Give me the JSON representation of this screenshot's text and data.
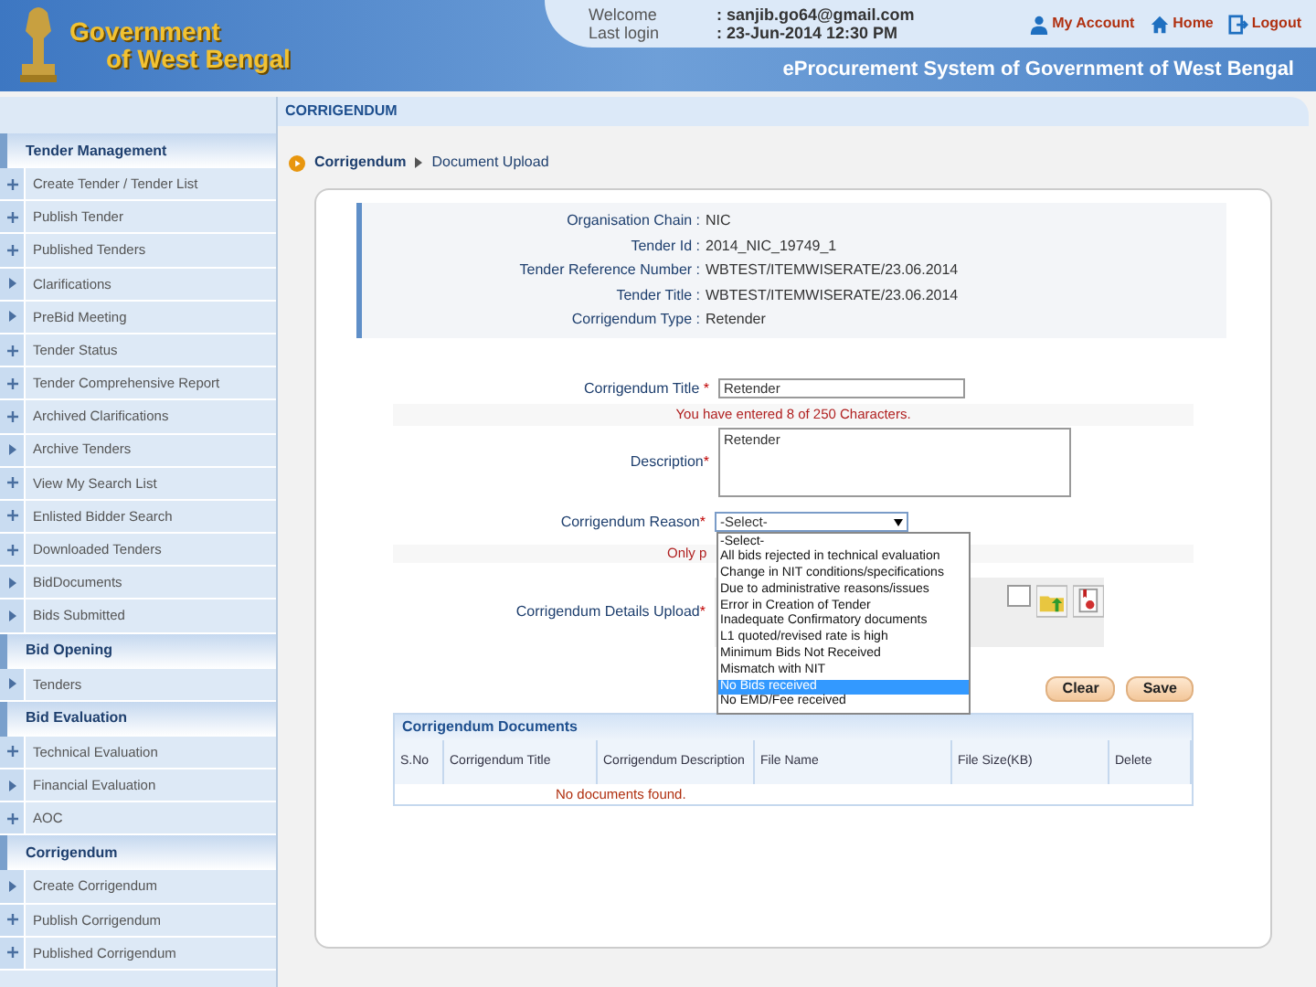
{
  "header": {
    "logo_lines": [
      "Government",
      "of West Bengal"
    ],
    "welcome_label": "Welcome",
    "welcome_value": ": sanjib.go64@gmail.com",
    "login_label": "Last login",
    "login_value": ": 23-Jun-2014 12:30 PM",
    "links": [
      {
        "label": "My Account",
        "kind": "user"
      },
      {
        "label": "Home",
        "kind": "home"
      },
      {
        "label": "Logout",
        "kind": "logout"
      }
    ],
    "system_title": "eProcurement System of Government of West Bengal"
  },
  "page_title": "CORRIGENDUM",
  "sidebar": [
    {
      "title": "Tender Management",
      "items": [
        {
          "label": "Create Tender / Tender List",
          "kind": "plus"
        },
        {
          "label": "Publish Tender",
          "kind": "plus"
        },
        {
          "label": "Published Tenders",
          "kind": "plus"
        },
        {
          "label": "Clarifications",
          "kind": "arrow"
        },
        {
          "label": "PreBid Meeting",
          "kind": "arrow"
        },
        {
          "label": "Tender Status",
          "kind": "plus"
        },
        {
          "label": "Tender Comprehensive Report",
          "kind": "plus"
        },
        {
          "label": "Archived Clarifications",
          "kind": "plus"
        },
        {
          "label": "Archive Tenders",
          "kind": "arrow"
        },
        {
          "label": "View My Search List",
          "kind": "plus"
        },
        {
          "label": "Enlisted Bidder Search",
          "kind": "plus"
        },
        {
          "label": "Downloaded Tenders",
          "kind": "plus"
        },
        {
          "label": "BidDocuments",
          "kind": "arrow"
        },
        {
          "label": "Bids Submitted",
          "kind": "arrow"
        }
      ]
    },
    {
      "title": "Bid Opening",
      "items": [
        {
          "label": "Tenders",
          "kind": "arrow"
        }
      ]
    },
    {
      "title": "Bid Evaluation",
      "items": [
        {
          "label": "Technical Evaluation",
          "kind": "plus"
        },
        {
          "label": "Financial Evaluation",
          "kind": "arrow"
        },
        {
          "label": "AOC",
          "kind": "plus"
        }
      ]
    },
    {
      "title": "Corrigendum",
      "items": [
        {
          "label": "Create Corrigendum",
          "kind": "arrow"
        },
        {
          "label": "Publish Corrigendum",
          "kind": "plus"
        },
        {
          "label": "Published Corrigendum",
          "kind": "plus"
        }
      ]
    }
  ],
  "breadcrumb": [
    "Corrigendum",
    "Document Upload"
  ],
  "info": [
    {
      "label": "Organisation Chain :",
      "value": "NIC"
    },
    {
      "label": "Tender Id :",
      "value": "2014_NIC_19749_1"
    },
    {
      "label": "Tender Reference Number :",
      "value": "WBTEST/ITEMWISERATE/23.06.2014"
    },
    {
      "label": "Tender Title :",
      "value": "WBTEST/ITEMWISERATE/23.06.2014"
    },
    {
      "label": "Corrigendum Type :",
      "value": "Retender"
    }
  ],
  "form": {
    "required_mark": "*",
    "title_label": "Corrigendum Title",
    "title_value": "Retender",
    "char_hint": "You have entered 8 of 250 Characters.",
    "description_label": "Description",
    "description_value": "Retender",
    "reason_label": "Corrigendum Reason",
    "reason_value": "-Select-",
    "reason_options": [
      {
        "label": "-Select-",
        "selected": false
      },
      {
        "label": "All bids rejected in technical evaluation",
        "selected": false
      },
      {
        "label": "Change in NIT conditions/specifications",
        "selected": false
      },
      {
        "label": "Due to administrative reasons/issues",
        "selected": false
      },
      {
        "label": "Error in Creation of Tender",
        "selected": false
      },
      {
        "label": "Inadequate Confirmatory documents",
        "selected": false
      },
      {
        "label": "L1 quoted/revised rate is high",
        "selected": false
      },
      {
        "label": "Minimum Bids Not Received",
        "selected": false
      },
      {
        "label": "Mismatch with NIT",
        "selected": false
      },
      {
        "label": "No Bids received",
        "selected": true
      },
      {
        "label": "No EMD/Fee received",
        "selected": false
      }
    ],
    "reason_hint": "Only p",
    "upload_label": "Corrigendum Details Upload",
    "buttons": [
      "Clear",
      "Save"
    ]
  },
  "documents": {
    "title": "Corrigendum Documents",
    "columns": [
      "S.No",
      "Corrigendum Title",
      "Corrigendum Description",
      "File Name",
      "File Size(KB)",
      "Delete"
    ],
    "empty": "No documents found."
  }
}
